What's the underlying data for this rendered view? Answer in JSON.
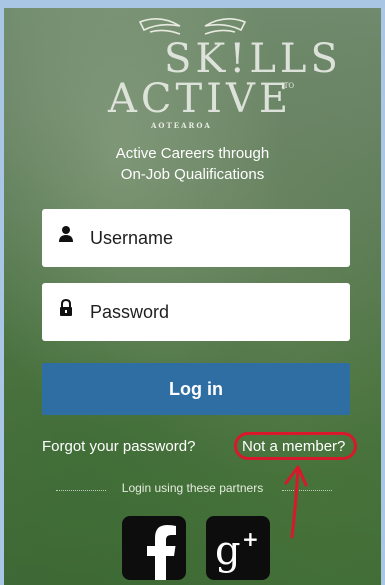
{
  "brand": {
    "line1": "SK!LLS",
    "line2": "ACTIVE",
    "suffix": "ITO",
    "sub": "AOTEAROA"
  },
  "tagline": {
    "line1": "Active Careers through",
    "line2": "On-Job Qualifications"
  },
  "form": {
    "username_label": "Username",
    "password_label": "Password",
    "login_label": "Log in"
  },
  "links": {
    "forgot": "Forgot your password?",
    "not_member": "Not a member?"
  },
  "partners": {
    "label": "Login using these partners",
    "items": [
      {
        "name": "Facebook",
        "icon": "facebook-icon"
      },
      {
        "name": "Google Plus",
        "icon": "google-plus-icon"
      }
    ]
  },
  "colors": {
    "login_button": "#2f6ea3",
    "annotation": "#d7192b"
  }
}
